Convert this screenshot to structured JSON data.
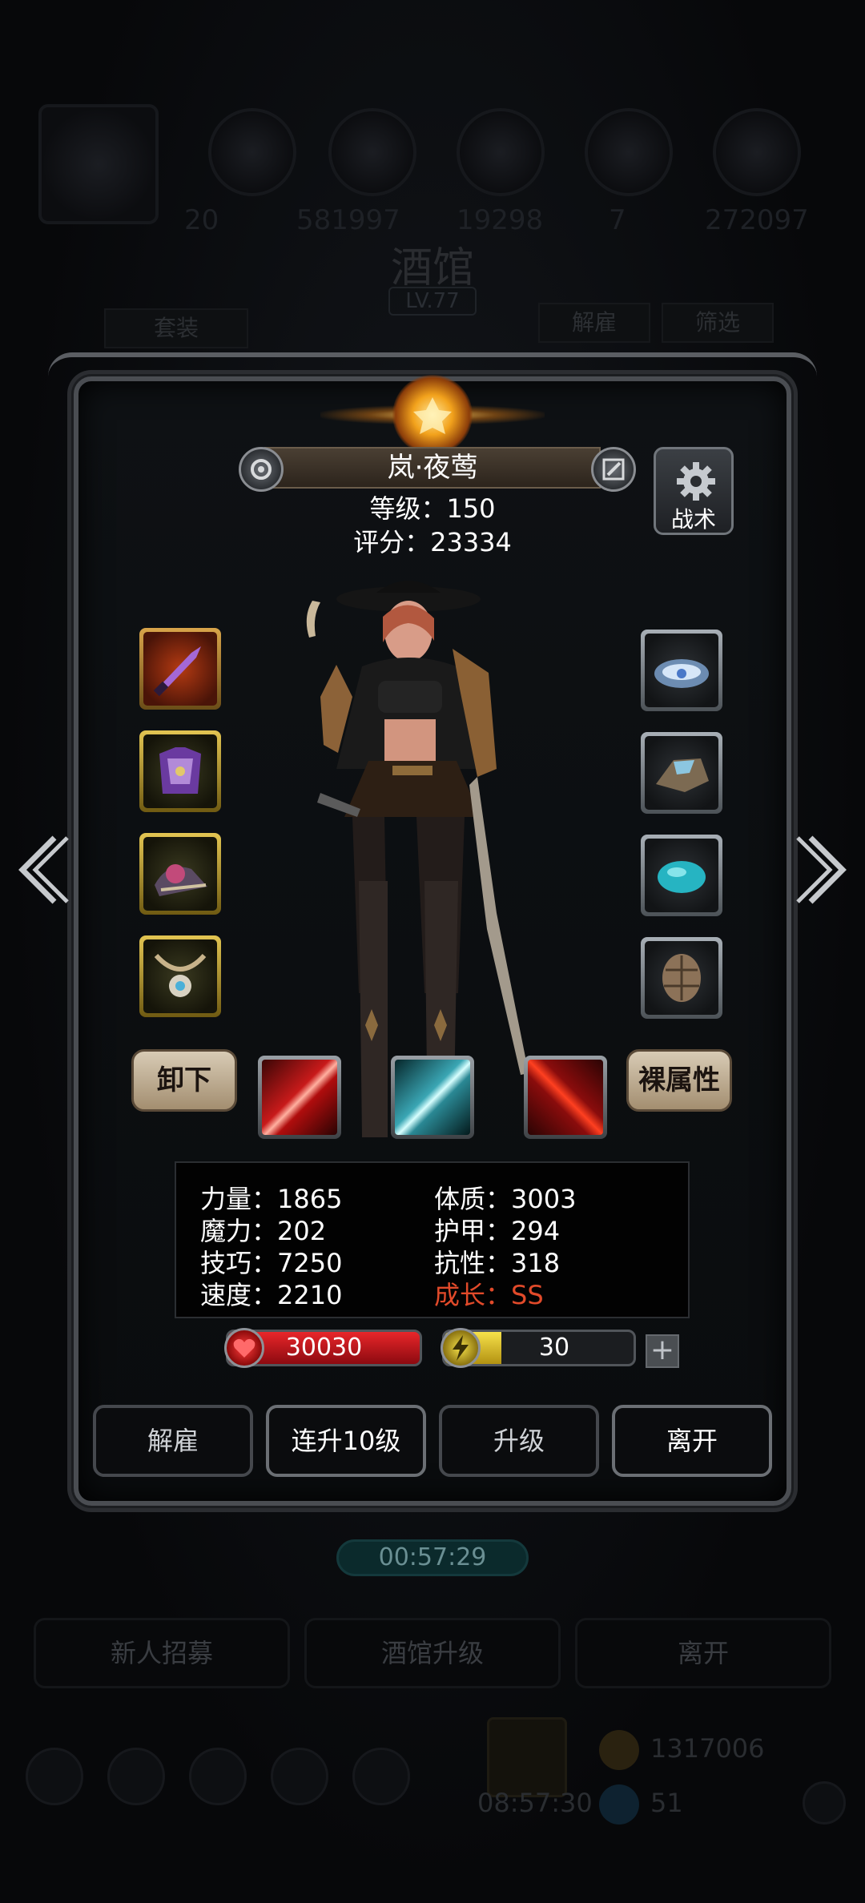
{
  "background": {
    "numbers": [
      "20",
      "581997",
      "19298",
      "7",
      "272097"
    ],
    "title": "酒馆",
    "level": "LV.77",
    "tabs": {
      "suit": "套装",
      "dismiss": "解雇",
      "filter": "筛选"
    },
    "timer": "00:57:29",
    "buttons": {
      "recruit": "新人招募",
      "upgrade": "酒馆升级",
      "leave": "离开"
    },
    "currency": {
      "gold": "1317006",
      "gems": "51"
    },
    "clock": "08:57:30"
  },
  "hero": {
    "name": "岚·夜莺",
    "level_label": "等级：150",
    "score_label": "评分：23334",
    "tactic_label": "战术"
  },
  "buttons": {
    "unequip": "卸下",
    "bare_attributes": "裸属性",
    "dismiss": "解雇",
    "level_up_10": "连升10级",
    "level_up": "升级",
    "leave": "离开",
    "plus": "+"
  },
  "stats": {
    "strength": "力量：1865",
    "constitution": "体质：3003",
    "magic": "魔力：202",
    "armor": "护甲：294",
    "skill": "技巧：7250",
    "resistance": "抗性：318",
    "speed": "速度：2210",
    "growth": "成长：SS"
  },
  "bars": {
    "hp": "30030",
    "energy": "30",
    "energy_fraction": 0.3
  },
  "icons": {
    "left_slots": [
      "dagger-icon",
      "armor-icon",
      "boots-icon",
      "amulet-icon"
    ],
    "right_slots": [
      "crown-icon",
      "ore-icon",
      "gem-icon",
      "shell-icon"
    ],
    "skills": [
      "red-slash-skill-icon",
      "cyan-slash-skill-icon",
      "red-blade-skill-icon"
    ]
  },
  "colors": {
    "growth": "#e14a2a",
    "hp": "#e8262a",
    "energy": "#f6e14a",
    "accent": "#f2a21c"
  }
}
